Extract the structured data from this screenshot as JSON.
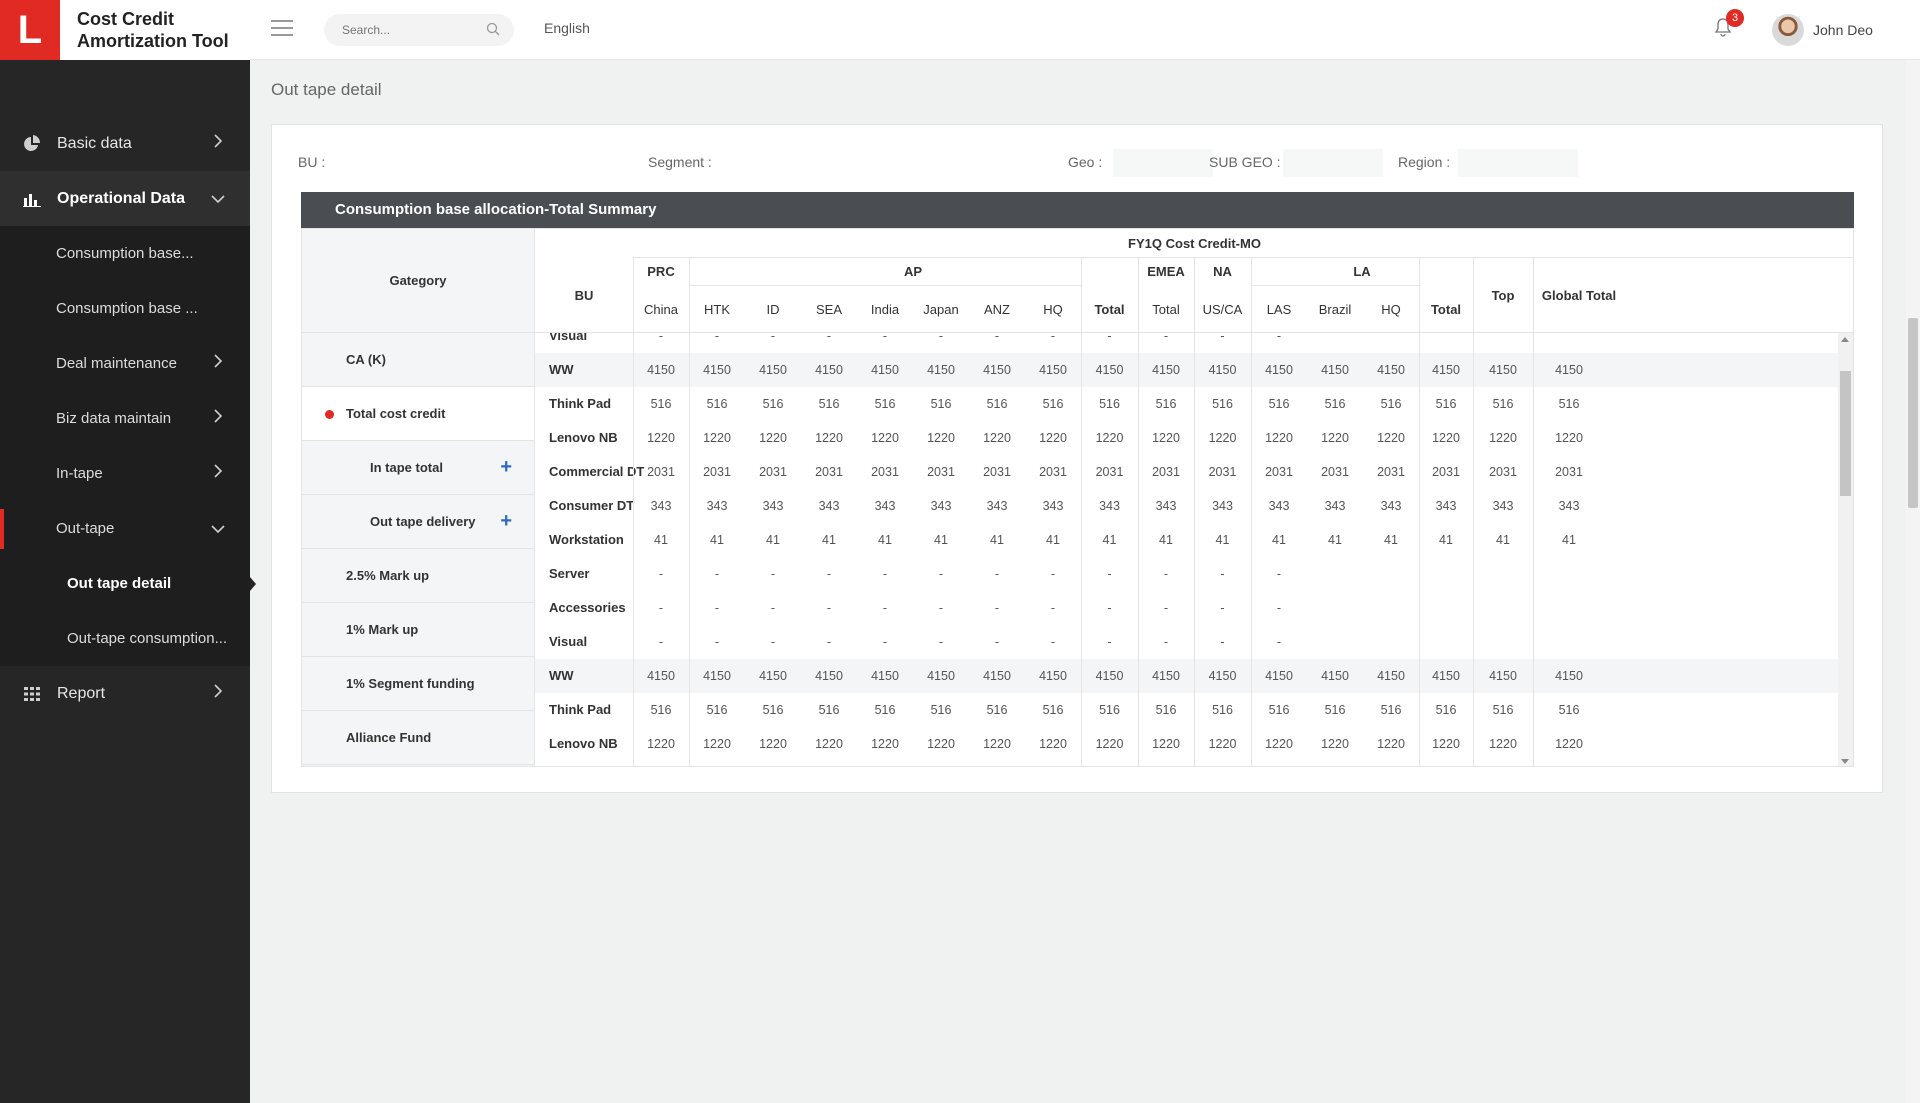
{
  "app": {
    "title": "Cost Credit Amortization Tool",
    "logo_letter": "L"
  },
  "header": {
    "search_placeholder": "Search...",
    "language": "English",
    "notifications": "3",
    "user": "John Deo"
  },
  "sidebar": {
    "basic_data": "Basic data",
    "operational_data": "Operational Data",
    "sub": [
      "Consumption base...",
      "Consumption base ...",
      "Deal maintenance",
      "Biz data maintain",
      "In-tape",
      "Out-tape"
    ],
    "out_tape_children": [
      "Out tape detail",
      "Out-tape consumption..."
    ],
    "report": "Report"
  },
  "page": {
    "title": "Out tape detail"
  },
  "filters": {
    "bu": "BU :",
    "segment": "Segment :",
    "geo": "Geo :",
    "sub_geo": "SUB GEO :",
    "region": "Region :"
  },
  "table": {
    "title": "Consumption base allocation-Total Summary",
    "category_header": "Gategory",
    "categories": [
      "CA (K)",
      "Total cost credit",
      "In tape total",
      "Out tape delivery",
      "2.5% Mark up",
      "1% Mark up",
      "1% Segment funding",
      "Alliance Fund"
    ],
    "fy_header": "FY1Q Cost Credit-MO",
    "bu_header": "BU",
    "groups": {
      "prc": "PRC",
      "ap": "AP",
      "emea": "EMEA",
      "na": "NA",
      "la": "LA",
      "top": "Top",
      "global_total": "Global Total"
    },
    "columns": [
      "China",
      "HTK",
      "ID",
      "SEA",
      "India",
      "Japan",
      "ANZ",
      "HQ",
      "Total",
      "Total",
      "US/CA",
      "LAS",
      "Brazil",
      "HQ",
      "Total"
    ],
    "rows": [
      {
        "bu": "Visual",
        "ww": false,
        "values": [
          "-",
          "-",
          "-",
          "-",
          "-",
          "-",
          "-",
          "-",
          "-",
          "-",
          "-",
          "-",
          "",
          "",
          "",
          "",
          ""
        ]
      },
      {
        "bu": "WW",
        "ww": true,
        "values": [
          "4150",
          "4150",
          "4150",
          "4150",
          "4150",
          "4150",
          "4150",
          "4150",
          "4150",
          "4150",
          "4150",
          "4150",
          "4150",
          "4150",
          "4150",
          "4150",
          "4150"
        ]
      },
      {
        "bu": "Think Pad",
        "ww": false,
        "values": [
          "516",
          "516",
          "516",
          "516",
          "516",
          "516",
          "516",
          "516",
          "516",
          "516",
          "516",
          "516",
          "516",
          "516",
          "516",
          "516",
          "516"
        ]
      },
      {
        "bu": "Lenovo NB",
        "ww": false,
        "values": [
          "1220",
          "1220",
          "1220",
          "1220",
          "1220",
          "1220",
          "1220",
          "1220",
          "1220",
          "1220",
          "1220",
          "1220",
          "1220",
          "1220",
          "1220",
          "1220",
          "1220"
        ]
      },
      {
        "bu": "Commercial DT",
        "ww": false,
        "values": [
          "2031",
          "2031",
          "2031",
          "2031",
          "2031",
          "2031",
          "2031",
          "2031",
          "2031",
          "2031",
          "2031",
          "2031",
          "2031",
          "2031",
          "2031",
          "2031",
          "2031"
        ]
      },
      {
        "bu": "Consumer DT",
        "ww": false,
        "values": [
          "343",
          "343",
          "343",
          "343",
          "343",
          "343",
          "343",
          "343",
          "343",
          "343",
          "343",
          "343",
          "343",
          "343",
          "343",
          "343",
          "343"
        ]
      },
      {
        "bu": "Workstation",
        "ww": false,
        "values": [
          "41",
          "41",
          "41",
          "41",
          "41",
          "41",
          "41",
          "41",
          "41",
          "41",
          "41",
          "41",
          "41",
          "41",
          "41",
          "41",
          "41"
        ]
      },
      {
        "bu": "Server",
        "ww": false,
        "values": [
          "-",
          "-",
          "-",
          "-",
          "-",
          "-",
          "-",
          "-",
          "-",
          "-",
          "-",
          "-",
          "",
          "",
          "",
          "",
          ""
        ]
      },
      {
        "bu": "Accessories",
        "ww": false,
        "values": [
          "-",
          "-",
          "-",
          "-",
          "-",
          "-",
          "-",
          "-",
          "-",
          "-",
          "-",
          "-",
          "",
          "",
          "",
          "",
          ""
        ]
      },
      {
        "bu": "Visual",
        "ww": false,
        "values": [
          "-",
          "-",
          "-",
          "-",
          "-",
          "-",
          "-",
          "-",
          "-",
          "-",
          "-",
          "-",
          "",
          "",
          "",
          "",
          ""
        ]
      },
      {
        "bu": "WW",
        "ww": true,
        "values": [
          "4150",
          "4150",
          "4150",
          "4150",
          "4150",
          "4150",
          "4150",
          "4150",
          "4150",
          "4150",
          "4150",
          "4150",
          "4150",
          "4150",
          "4150",
          "4150",
          "4150"
        ]
      },
      {
        "bu": "Think Pad",
        "ww": false,
        "values": [
          "516",
          "516",
          "516",
          "516",
          "516",
          "516",
          "516",
          "516",
          "516",
          "516",
          "516",
          "516",
          "516",
          "516",
          "516",
          "516",
          "516"
        ]
      },
      {
        "bu": "Lenovo NB",
        "ww": false,
        "values": [
          "1220",
          "1220",
          "1220",
          "1220",
          "1220",
          "1220",
          "1220",
          "1220",
          "1220",
          "1220",
          "1220",
          "1220",
          "1220",
          "1220",
          "1220",
          "1220",
          "1220"
        ]
      }
    ]
  }
}
